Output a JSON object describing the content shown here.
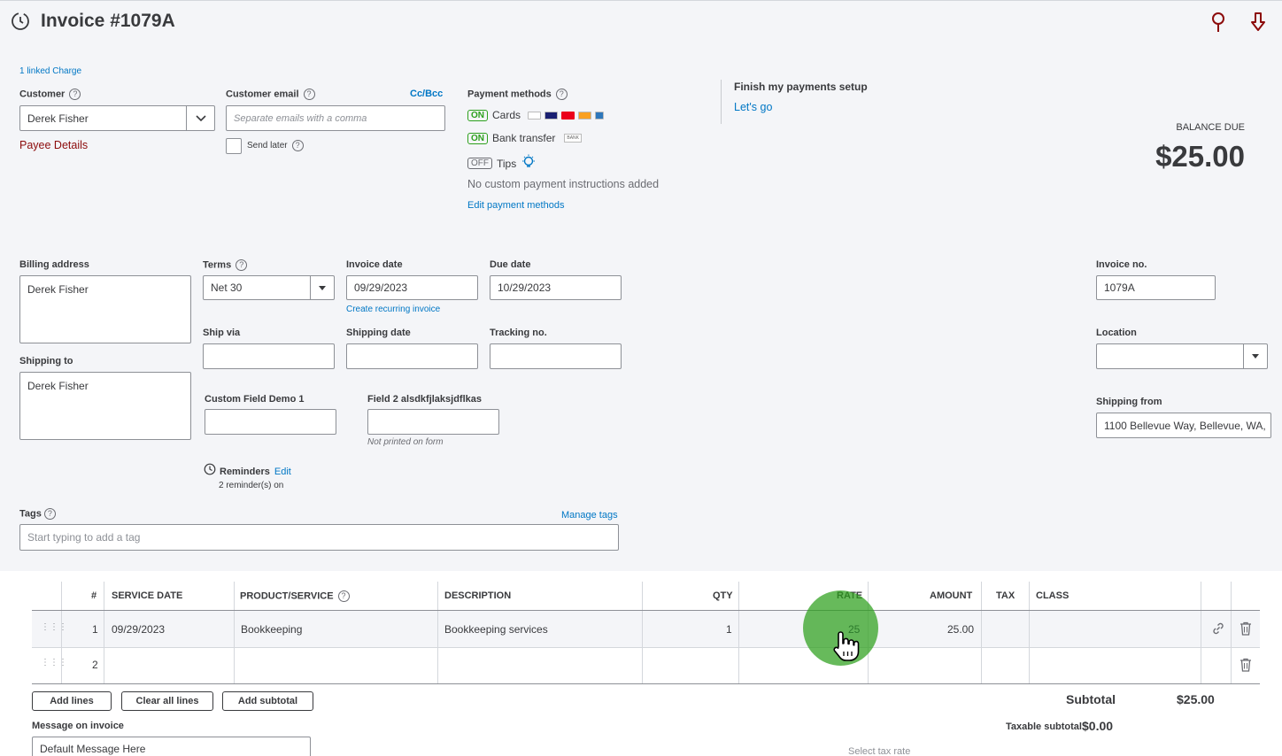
{
  "header": {
    "title": "Invoice #1079A",
    "history_icon": "history-icon",
    "pin_icon": "map-pin-icon",
    "download_icon": "download-icon",
    "accent_color": "#8c0b0b"
  },
  "linked_charge": "1 linked Charge",
  "customer": {
    "label": "Customer",
    "value": "Derek Fisher",
    "payee_details": "Payee Details"
  },
  "email": {
    "label": "Customer email",
    "cc_bcc": "Cc/Bcc",
    "placeholder": "Separate emails with a comma",
    "send_later": "Send later"
  },
  "payment_methods": {
    "label": "Payment methods",
    "cards_state": "ON",
    "cards_label": "Cards",
    "bank_state": "ON",
    "bank_label": "Bank transfer",
    "bank_badge": "BANK",
    "tips_state": "OFF",
    "tips_label": "Tips",
    "no_instructions": "No custom payment instructions added",
    "edit_link": "Edit payment methods"
  },
  "payments_setup": {
    "title": "Finish my payments setup",
    "link": "Let's go"
  },
  "balance": {
    "label": "BALANCE DUE",
    "amount": "$25.00"
  },
  "billing": {
    "label": "Billing address",
    "value": "Derek Fisher"
  },
  "shipping_to": {
    "label": "Shipping to",
    "value": "Derek Fisher"
  },
  "terms": {
    "label": "Terms",
    "value": "Net 30"
  },
  "invoice_date": {
    "label": "Invoice date",
    "value": "09/29/2023",
    "recurring_link": "Create recurring invoice"
  },
  "due_date": {
    "label": "Due date",
    "value": "10/29/2023"
  },
  "invoice_no": {
    "label": "Invoice no.",
    "value": "1079A"
  },
  "ship_via": {
    "label": "Ship via",
    "value": ""
  },
  "shipping_date": {
    "label": "Shipping date",
    "value": ""
  },
  "tracking_no": {
    "label": "Tracking no.",
    "value": ""
  },
  "location": {
    "label": "Location",
    "value": ""
  },
  "custom_field_1": {
    "label": "Custom Field Demo 1",
    "value": ""
  },
  "custom_field_2": {
    "label": "Field 2 alsdkfjlaksjdflkas",
    "value": "",
    "note": "Not printed on form"
  },
  "shipping_from": {
    "label": "Shipping from",
    "value": "1100 Bellevue Way, Bellevue, WA,"
  },
  "reminders": {
    "label": "Reminders",
    "edit": "Edit",
    "status": "2 reminder(s) on"
  },
  "tags": {
    "label": "Tags",
    "manage": "Manage tags",
    "placeholder": "Start typing to add a tag"
  },
  "table": {
    "headers": {
      "num": "#",
      "service_date": "SERVICE DATE",
      "product": "PRODUCT/SERVICE",
      "description": "DESCRIPTION",
      "qty": "QTY",
      "rate": "RATE",
      "amount": "AMOUNT",
      "tax": "TAX",
      "class": "CLASS"
    },
    "rows": [
      {
        "num": "1",
        "service_date": "09/29/2023",
        "product": "Bookkeeping",
        "description": "Bookkeeping services",
        "qty": "1",
        "rate": "25",
        "amount": "25.00"
      },
      {
        "num": "2",
        "service_date": "",
        "product": "",
        "description": "",
        "qty": "",
        "rate": "",
        "amount": ""
      }
    ]
  },
  "buttons": {
    "add_lines": "Add lines",
    "clear_lines": "Clear all lines",
    "add_subtotal": "Add subtotal"
  },
  "message": {
    "label": "Message on invoice",
    "value": "Default Message Here"
  },
  "totals": {
    "subtotal_label": "Subtotal",
    "subtotal_value": "$25.00",
    "taxable_label": "Taxable subtotal",
    "taxable_value": "$0.00",
    "tax_rate_placeholder": "Select tax rate"
  },
  "cursor": {
    "highlight_color": "#2ca01c"
  }
}
